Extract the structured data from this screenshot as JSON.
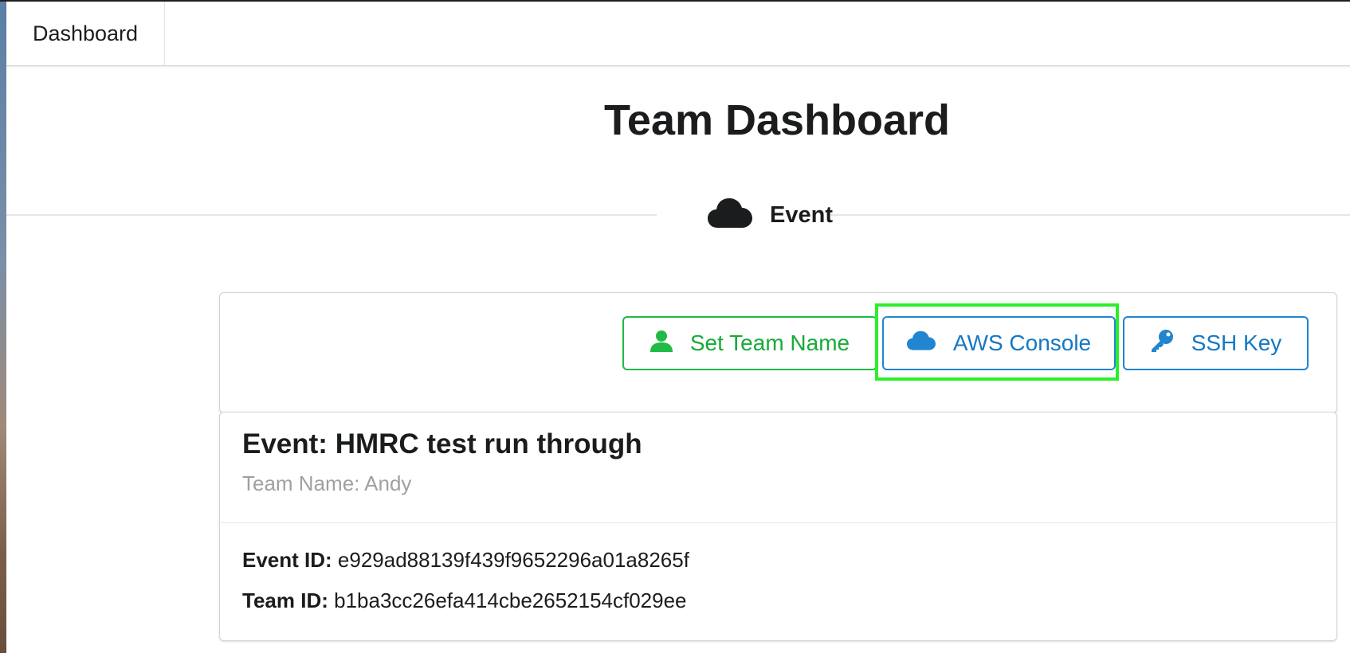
{
  "menu": {
    "dashboard_label": "Dashboard"
  },
  "page": {
    "title": "Team Dashboard"
  },
  "section": {
    "label": "Event",
    "icon": "cloud-icon"
  },
  "actions": [
    {
      "label": "Set Team Name",
      "icon": "user-icon",
      "color": "#21ba45"
    },
    {
      "label": "AWS Console",
      "icon": "cloud-icon",
      "color": "#2185d0"
    },
    {
      "label": "SSH Key",
      "icon": "key-icon",
      "color": "#2185d0"
    }
  ],
  "event": {
    "title": "Event: HMRC test run through",
    "team_name_line": "Team Name: Andy",
    "event_id_label": "Event ID:",
    "event_id_value": "e929ad88139f439f9652296a01a8265f",
    "team_id_label": "Team ID:",
    "team_id_value": "b1ba3cc26efa414cbe2652154cf029ee"
  },
  "colors": {
    "highlight": "#2bef2b",
    "green": "#21ba45",
    "blue": "#2185d0"
  }
}
